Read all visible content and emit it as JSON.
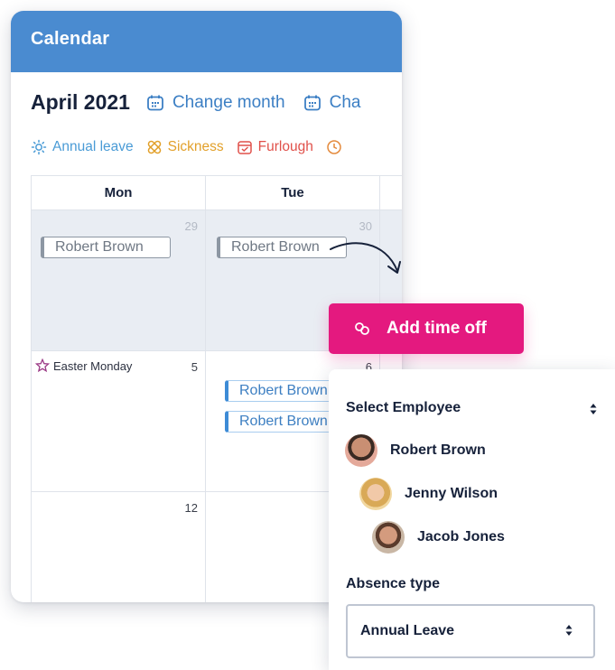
{
  "calendar": {
    "title": "Calendar",
    "month": "April 2021",
    "change_month_label": "Change month",
    "change_other_label": "Cha",
    "legend": [
      {
        "label": "Annual leave",
        "icon": "sun-icon",
        "color": "#4a9bd6"
      },
      {
        "label": "Sickness",
        "icon": "bandage-icon",
        "color": "#e2a02a"
      },
      {
        "label": "Furlough",
        "icon": "calendar-check-icon",
        "color": "#e0504a"
      }
    ],
    "weekdays": [
      "Mon",
      "Tue"
    ],
    "days": {
      "r0c0": "29",
      "r0c1": "30",
      "r1c0": "5",
      "r1c1": "6",
      "r2c0": "12"
    },
    "holiday": "Easter Monday",
    "entries": {
      "r0c0": "Robert Brown",
      "r0c1": "Robert Brown",
      "r1c1_a": "Robert Brown",
      "r1c1_b": "Robert Brown"
    }
  },
  "add_time_off": {
    "label": "Add time off",
    "color": "#e4197f"
  },
  "panel": {
    "select_employee_label": "Select Employee",
    "employees": [
      {
        "name": "Robert Brown"
      },
      {
        "name": "Jenny Wilson"
      },
      {
        "name": "Jacob Jones"
      }
    ],
    "absence_type_label": "Absence type",
    "absence_type_value": "Annual Leave"
  },
  "colors": {
    "header": "#4a8bd0",
    "accent_pink": "#e4197f",
    "entry_blue": "#3d8bd6",
    "entry_grey": "#8d97a3"
  }
}
